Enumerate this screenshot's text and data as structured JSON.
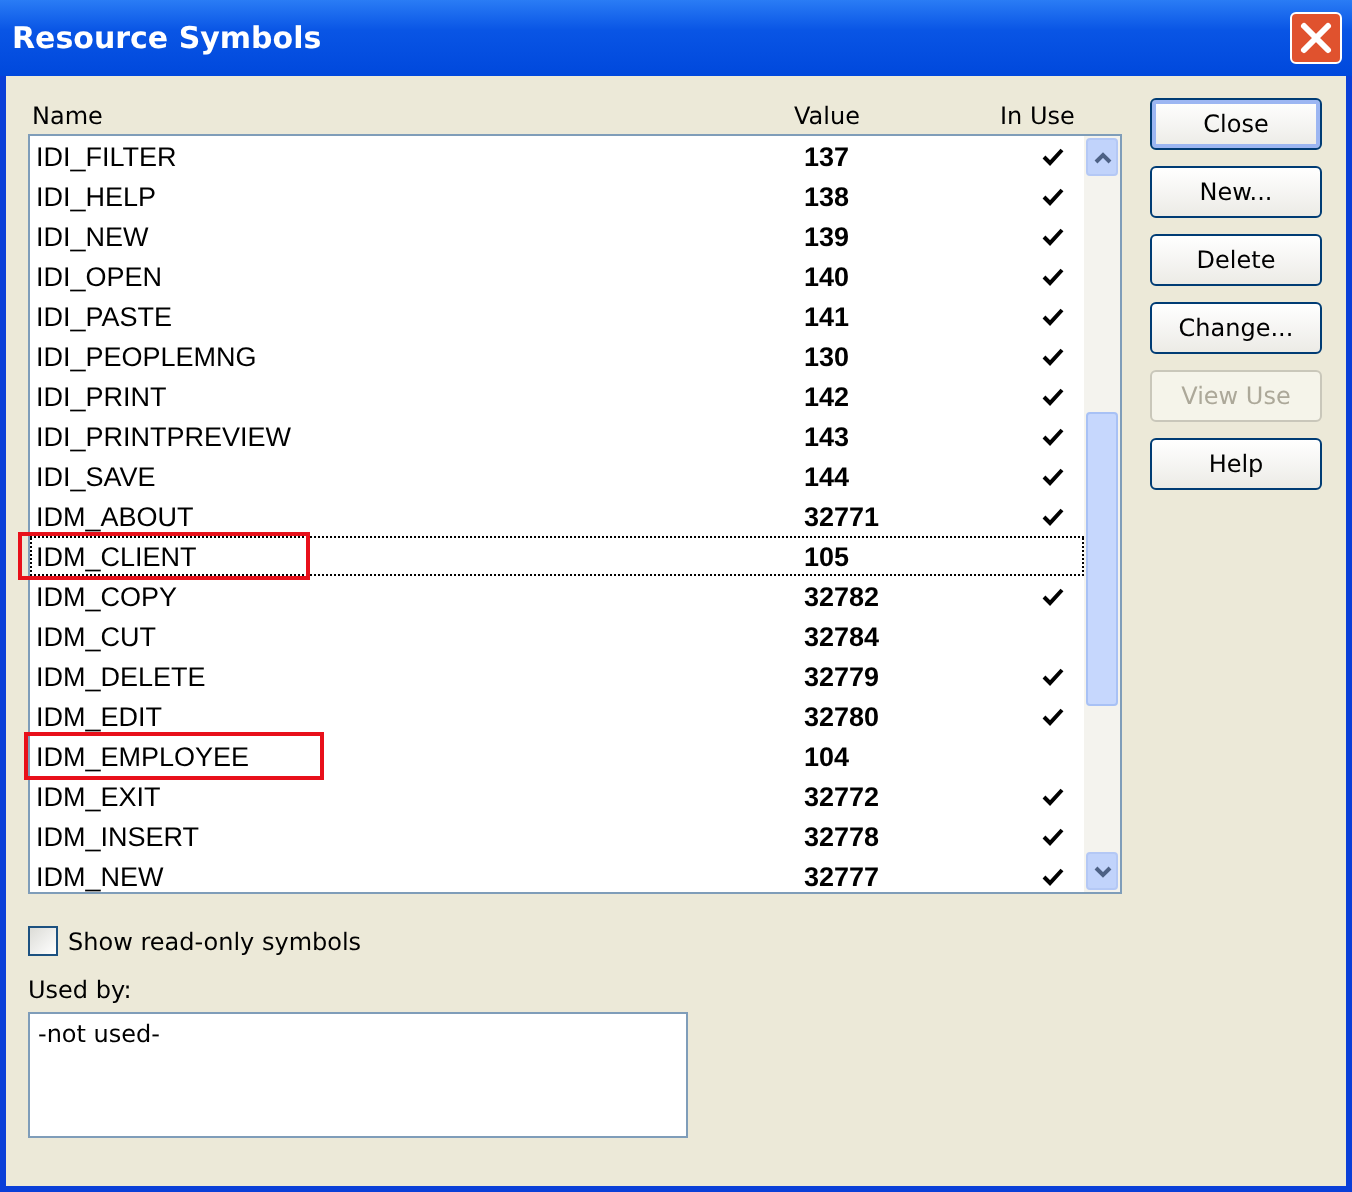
{
  "window": {
    "title": "Resource Symbols"
  },
  "table": {
    "columns": [
      "Name",
      "Value",
      "In Use"
    ],
    "rows": [
      {
        "name": "IDI_FILTER",
        "value": "137",
        "in_use": true,
        "focused": false,
        "marked": false
      },
      {
        "name": "IDI_HELP",
        "value": "138",
        "in_use": true,
        "focused": false,
        "marked": false
      },
      {
        "name": "IDI_NEW",
        "value": "139",
        "in_use": true,
        "focused": false,
        "marked": false
      },
      {
        "name": "IDI_OPEN",
        "value": "140",
        "in_use": true,
        "focused": false,
        "marked": false
      },
      {
        "name": "IDI_PASTE",
        "value": "141",
        "in_use": true,
        "focused": false,
        "marked": false
      },
      {
        "name": "IDI_PEOPLEMNG",
        "value": "130",
        "in_use": true,
        "focused": false,
        "marked": false
      },
      {
        "name": "IDI_PRINT",
        "value": "142",
        "in_use": true,
        "focused": false,
        "marked": false
      },
      {
        "name": "IDI_PRINTPREVIEW",
        "value": "143",
        "in_use": true,
        "focused": false,
        "marked": false
      },
      {
        "name": "IDI_SAVE",
        "value": "144",
        "in_use": true,
        "focused": false,
        "marked": false
      },
      {
        "name": "IDM_ABOUT",
        "value": "32771",
        "in_use": true,
        "focused": false,
        "marked": false
      },
      {
        "name": "IDM_CLIENT",
        "value": "105",
        "in_use": false,
        "focused": true,
        "marked": true
      },
      {
        "name": "IDM_COPY",
        "value": "32782",
        "in_use": true,
        "focused": false,
        "marked": false
      },
      {
        "name": "IDM_CUT",
        "value": "32784",
        "in_use": false,
        "focused": false,
        "marked": false
      },
      {
        "name": "IDM_DELETE",
        "value": "32779",
        "in_use": true,
        "focused": false,
        "marked": false
      },
      {
        "name": "IDM_EDIT",
        "value": "32780",
        "in_use": true,
        "focused": false,
        "marked": false
      },
      {
        "name": "IDM_EMPLOYEE",
        "value": "104",
        "in_use": false,
        "focused": false,
        "marked": true
      },
      {
        "name": "IDM_EXIT",
        "value": "32772",
        "in_use": true,
        "focused": false,
        "marked": false
      },
      {
        "name": "IDM_INSERT",
        "value": "32778",
        "in_use": true,
        "focused": false,
        "marked": false
      },
      {
        "name": "IDM_NEW",
        "value": "32777",
        "in_use": true,
        "focused": false,
        "marked": false
      }
    ]
  },
  "buttons": [
    {
      "label": "Close",
      "disabled": false,
      "default": true
    },
    {
      "label": "New...",
      "disabled": false,
      "default": false
    },
    {
      "label": "Delete",
      "disabled": false,
      "default": false
    },
    {
      "label": "Change...",
      "disabled": false,
      "default": false
    },
    {
      "label": "View Use",
      "disabled": true,
      "default": false
    },
    {
      "label": "Help",
      "disabled": false,
      "default": false
    }
  ],
  "show_read_only": {
    "label": "Show read-only symbols",
    "checked": false
  },
  "used_by": {
    "label": "Used by:",
    "value": "-not used-"
  }
}
